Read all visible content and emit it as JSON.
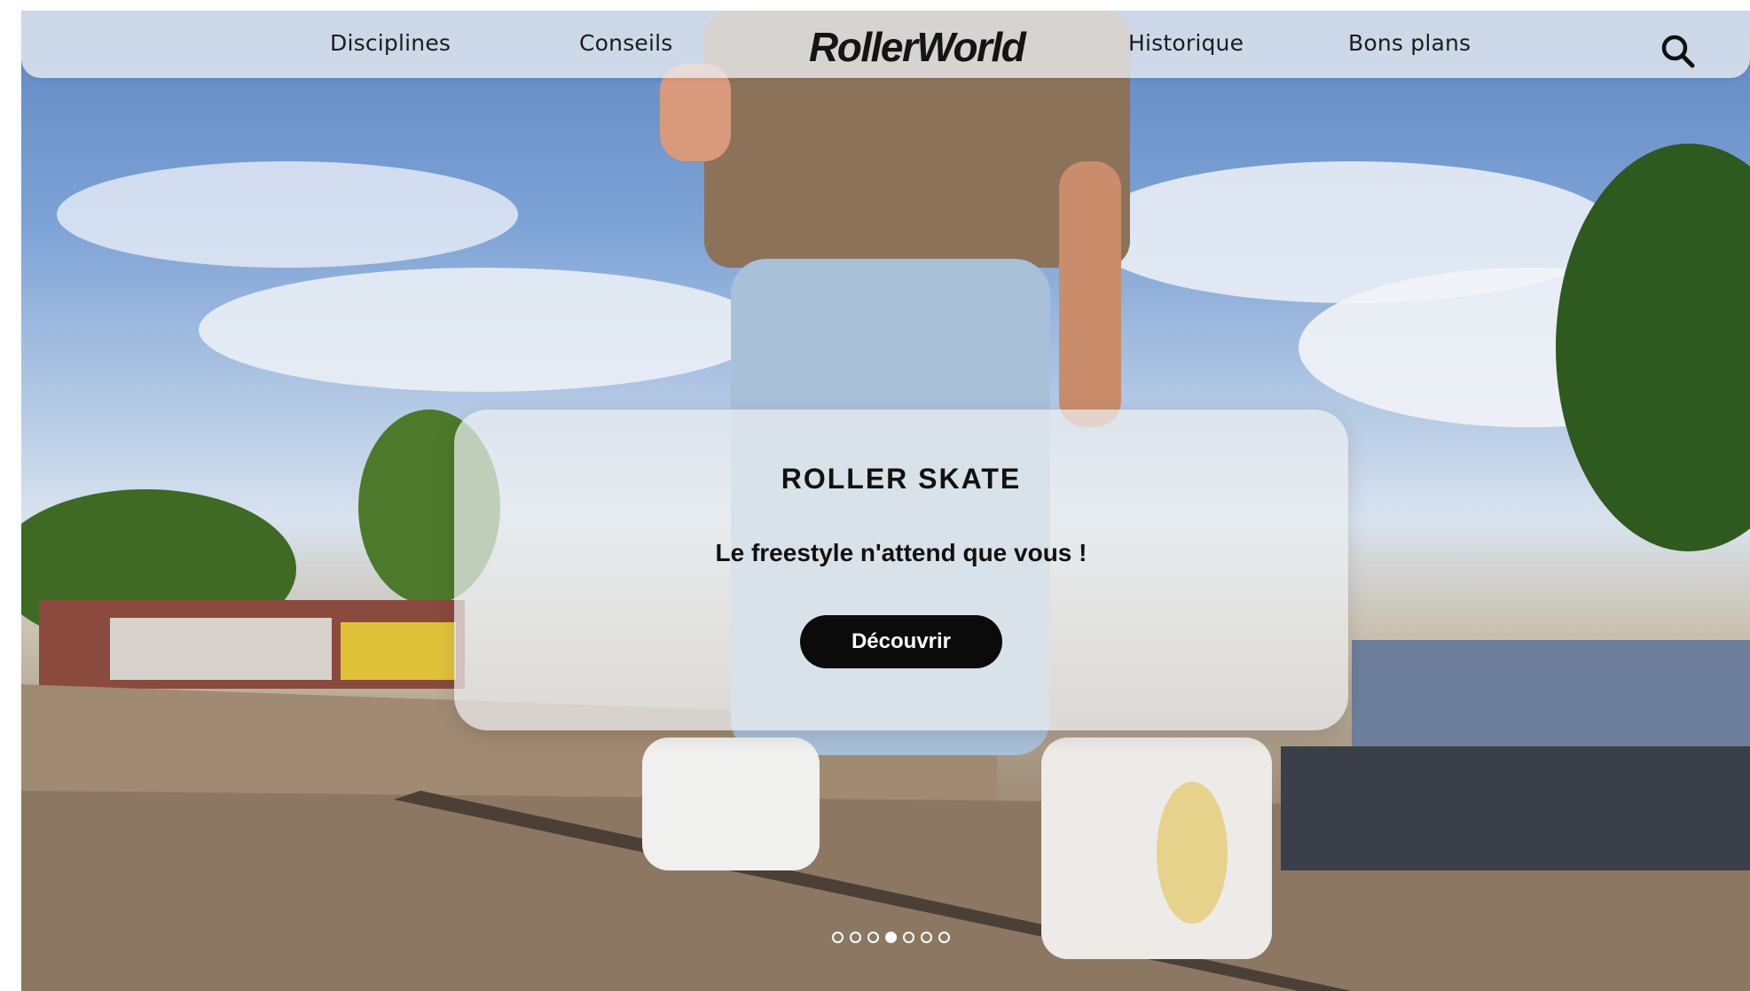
{
  "nav": {
    "items": [
      {
        "label": "Disciplines"
      },
      {
        "label": "Conseils"
      },
      {
        "label": "Historique"
      },
      {
        "label": "Bons plans"
      }
    ],
    "logo_text": "RollerWorld",
    "search_icon": "search-icon"
  },
  "hero": {
    "image": "inline-skater-at-skatepark-photo",
    "card": {
      "title": "ROLLER SKATE",
      "subtitle": "Le freestyle n'attend que vous !",
      "button_label": "Découvrir"
    }
  },
  "carousel": {
    "slide_count": 7,
    "active_index": 3
  },
  "colors": {
    "button_bg": "#0b0b0b",
    "button_text": "#ffffff",
    "nav_text": "#1c1c1c"
  }
}
